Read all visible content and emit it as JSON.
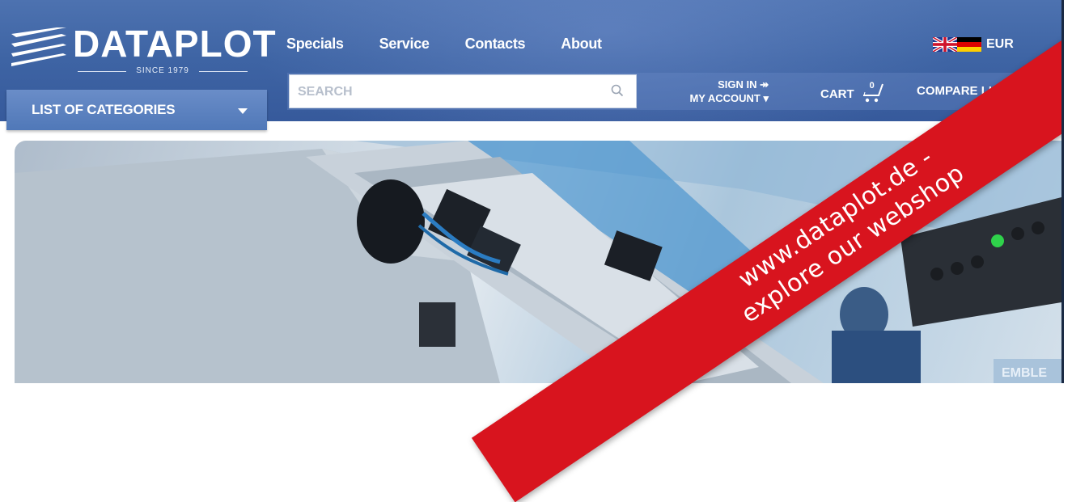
{
  "brand": {
    "name": "DATAPLOT",
    "since": "SINCE 1979"
  },
  "nav": {
    "items": [
      {
        "label": "Specials"
      },
      {
        "label": "Service"
      },
      {
        "label": "Contacts"
      },
      {
        "label": "About"
      }
    ]
  },
  "currency": {
    "label": "EUR",
    "flags": [
      "uk-flag-icon",
      "germany-flag-icon"
    ]
  },
  "search": {
    "placeholder": "SEARCH",
    "icon": "search-icon"
  },
  "account": {
    "sign_in": "SIGN IN ↠",
    "my_account": "MY ACCOUNT ▾"
  },
  "cart": {
    "label": "CART",
    "count": "0",
    "icon": "cart-icon"
  },
  "compare": {
    "label": "COMPARE LIST"
  },
  "categories": {
    "label": "LIST OF CATEGORIES",
    "icon": "caret-down-icon"
  },
  "banner": {
    "line1": "www.dataplot.de -",
    "line2": "explore our webshop"
  },
  "colors": {
    "header": "#4068a8",
    "banner": "#d8141e",
    "button": "#5a80be"
  }
}
